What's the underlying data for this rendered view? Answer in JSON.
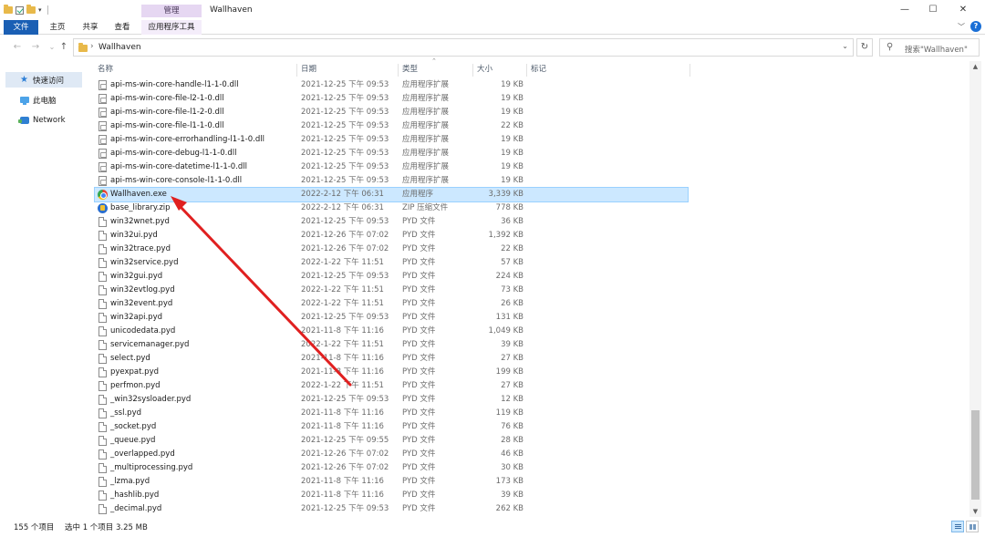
{
  "window": {
    "title": "Wallhaven",
    "context_tab": "管理",
    "controls": {
      "minimize": "—",
      "maximize": "☐",
      "close": "✕"
    }
  },
  "ribbon": {
    "tabs": [
      "文件",
      "主页",
      "共享",
      "查看",
      "应用程序工具"
    ],
    "help": "?"
  },
  "nav": {
    "back": "←",
    "forward": "→",
    "recent": "⌄",
    "up": "↑",
    "path": "Wallhaven",
    "refresh": "↻",
    "search_placeholder": "搜索\"Wallhaven\""
  },
  "sidebar": {
    "items": [
      {
        "label": "快速访问",
        "icon": "star-icon"
      },
      {
        "label": "此电脑",
        "icon": "computer-icon"
      },
      {
        "label": "Network",
        "icon": "network-icon"
      }
    ]
  },
  "columns": {
    "name": "名称",
    "date": "日期",
    "type": "类型",
    "size": "大小",
    "tags": "标记"
  },
  "files": [
    {
      "name": "api-ms-win-core-handle-l1-1-0.dll",
      "date": "2021-12-25 下午 09:53",
      "type": "应用程序扩展",
      "size": "19 KB",
      "icon": "dll"
    },
    {
      "name": "api-ms-win-core-file-l2-1-0.dll",
      "date": "2021-12-25 下午 09:53",
      "type": "应用程序扩展",
      "size": "19 KB",
      "icon": "dll"
    },
    {
      "name": "api-ms-win-core-file-l1-2-0.dll",
      "date": "2021-12-25 下午 09:53",
      "type": "应用程序扩展",
      "size": "19 KB",
      "icon": "dll"
    },
    {
      "name": "api-ms-win-core-file-l1-1-0.dll",
      "date": "2021-12-25 下午 09:53",
      "type": "应用程序扩展",
      "size": "22 KB",
      "icon": "dll"
    },
    {
      "name": "api-ms-win-core-errorhandling-l1-1-0.dll",
      "date": "2021-12-25 下午 09:53",
      "type": "应用程序扩展",
      "size": "19 KB",
      "icon": "dll"
    },
    {
      "name": "api-ms-win-core-debug-l1-1-0.dll",
      "date": "2021-12-25 下午 09:53",
      "type": "应用程序扩展",
      "size": "19 KB",
      "icon": "dll"
    },
    {
      "name": "api-ms-win-core-datetime-l1-1-0.dll",
      "date": "2021-12-25 下午 09:53",
      "type": "应用程序扩展",
      "size": "19 KB",
      "icon": "dll"
    },
    {
      "name": "api-ms-win-core-console-l1-1-0.dll",
      "date": "2021-12-25 下午 09:53",
      "type": "应用程序扩展",
      "size": "19 KB",
      "icon": "dll"
    },
    {
      "name": "Wallhaven.exe",
      "date": "2022-2-12 下午 06:31",
      "type": "应用程序",
      "size": "3,339 KB",
      "icon": "exe",
      "selected": true
    },
    {
      "name": "base_library.zip",
      "date": "2022-2-12 下午 06:31",
      "type": "ZIP 压缩文件",
      "size": "778 KB",
      "icon": "zip"
    },
    {
      "name": "win32wnet.pyd",
      "date": "2021-12-25 下午 09:53",
      "type": "PYD 文件",
      "size": "36 KB",
      "icon": "doc"
    },
    {
      "name": "win32ui.pyd",
      "date": "2021-12-26 下午 07:02",
      "type": "PYD 文件",
      "size": "1,392 KB",
      "icon": "doc"
    },
    {
      "name": "win32trace.pyd",
      "date": "2021-12-26 下午 07:02",
      "type": "PYD 文件",
      "size": "22 KB",
      "icon": "doc"
    },
    {
      "name": "win32service.pyd",
      "date": "2022-1-22 下午 11:51",
      "type": "PYD 文件",
      "size": "57 KB",
      "icon": "doc"
    },
    {
      "name": "win32gui.pyd",
      "date": "2021-12-25 下午 09:53",
      "type": "PYD 文件",
      "size": "224 KB",
      "icon": "doc"
    },
    {
      "name": "win32evtlog.pyd",
      "date": "2022-1-22 下午 11:51",
      "type": "PYD 文件",
      "size": "73 KB",
      "icon": "doc"
    },
    {
      "name": "win32event.pyd",
      "date": "2022-1-22 下午 11:51",
      "type": "PYD 文件",
      "size": "26 KB",
      "icon": "doc"
    },
    {
      "name": "win32api.pyd",
      "date": "2021-12-25 下午 09:53",
      "type": "PYD 文件",
      "size": "131 KB",
      "icon": "doc"
    },
    {
      "name": "unicodedata.pyd",
      "date": "2021-11-8 下午 11:16",
      "type": "PYD 文件",
      "size": "1,049 KB",
      "icon": "doc"
    },
    {
      "name": "servicemanager.pyd",
      "date": "2022-1-22 下午 11:51",
      "type": "PYD 文件",
      "size": "39 KB",
      "icon": "doc"
    },
    {
      "name": "select.pyd",
      "date": "2021-11-8 下午 11:16",
      "type": "PYD 文件",
      "size": "27 KB",
      "icon": "doc"
    },
    {
      "name": "pyexpat.pyd",
      "date": "2021-11-8 下午 11:16",
      "type": "PYD 文件",
      "size": "199 KB",
      "icon": "doc"
    },
    {
      "name": "perfmon.pyd",
      "date": "2022-1-22 下午 11:51",
      "type": "PYD 文件",
      "size": "27 KB",
      "icon": "doc"
    },
    {
      "name": "_win32sysloader.pyd",
      "date": "2021-12-25 下午 09:53",
      "type": "PYD 文件",
      "size": "12 KB",
      "icon": "doc"
    },
    {
      "name": "_ssl.pyd",
      "date": "2021-11-8 下午 11:16",
      "type": "PYD 文件",
      "size": "119 KB",
      "icon": "doc"
    },
    {
      "name": "_socket.pyd",
      "date": "2021-11-8 下午 11:16",
      "type": "PYD 文件",
      "size": "76 KB",
      "icon": "doc"
    },
    {
      "name": "_queue.pyd",
      "date": "2021-12-25 下午 09:55",
      "type": "PYD 文件",
      "size": "28 KB",
      "icon": "doc"
    },
    {
      "name": "_overlapped.pyd",
      "date": "2021-12-26 下午 07:02",
      "type": "PYD 文件",
      "size": "46 KB",
      "icon": "doc"
    },
    {
      "name": "_multiprocessing.pyd",
      "date": "2021-12-26 下午 07:02",
      "type": "PYD 文件",
      "size": "30 KB",
      "icon": "doc"
    },
    {
      "name": "_lzma.pyd",
      "date": "2021-11-8 下午 11:16",
      "type": "PYD 文件",
      "size": "173 KB",
      "icon": "doc"
    },
    {
      "name": "_hashlib.pyd",
      "date": "2021-11-8 下午 11:16",
      "type": "PYD 文件",
      "size": "39 KB",
      "icon": "doc"
    },
    {
      "name": "_decimal.pyd",
      "date": "2021-12-25 下午 09:53",
      "type": "PYD 文件",
      "size": "262 KB",
      "icon": "doc"
    }
  ],
  "status": {
    "item_count": "155 个项目",
    "selection": "选中 1 个项目  3.25 MB"
  },
  "colors": {
    "accent": "#1a5fb4",
    "selection": "#cce8ff",
    "manage_tab": "#e6d7f2",
    "arrow": "#e02020"
  }
}
